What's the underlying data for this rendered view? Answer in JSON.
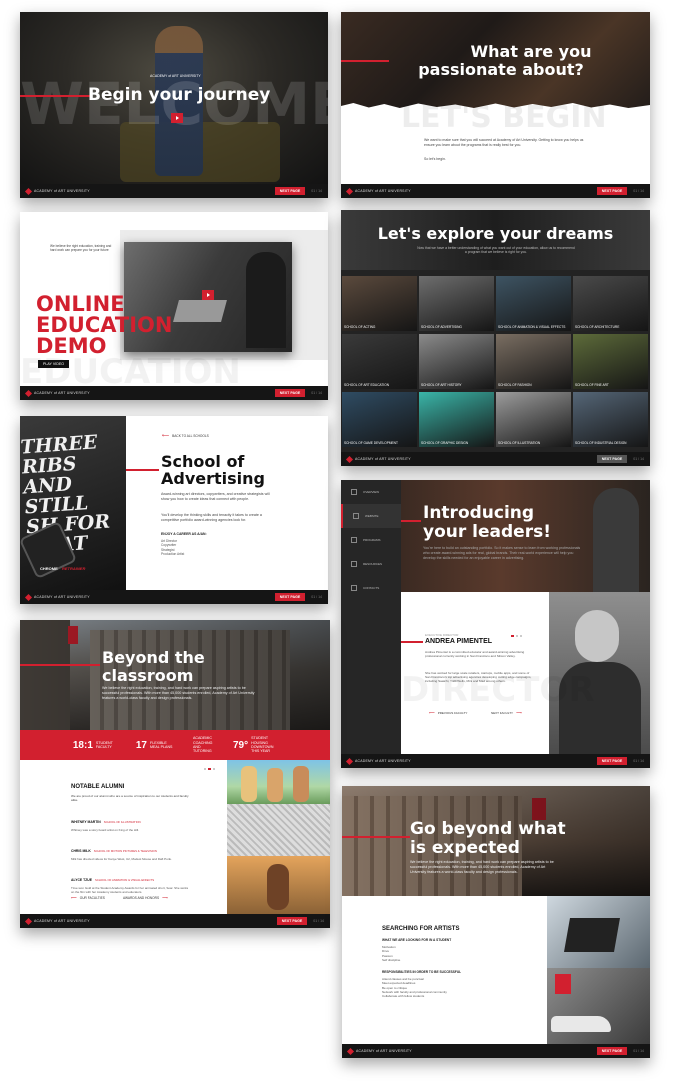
{
  "footer": {
    "brand": "ACADEMY of ART UNIVERSITY",
    "next_label": "NEXT PAGE",
    "page": "01 / 14"
  },
  "card1": {
    "ghost": "WELCOME",
    "headline": "Begin your journey",
    "logo": "ACADEMY of ART UNIVERSITY"
  },
  "card2": {
    "ghost": "LET'S BEGIN",
    "headline_line1": "What are you",
    "headline_line2": "passionate about?",
    "body": "We want to make sure that you will succeed at Academy of Art University. Getting to know you helps us ensure you learn about the programs that is really best for you.",
    "signoff": "So let's begin."
  },
  "card3": {
    "intro": "We believe the right education, training and hard work can prepare you for your future",
    "headline_line1": "ONLINE",
    "headline_line2": "EDUCATION",
    "headline_line3": "DEMO",
    "button": "PLAY VIDEO",
    "ghost": "EDUCATION"
  },
  "card4": {
    "headline": "Let's explore your dreams",
    "subtitle": "Now that we have a better understanding of what you want out of your education, allow us to recommend a program that we believe is right for you.",
    "schools": [
      "SCHOOL OF ACTING",
      "SCHOOL OF ADVERTISING",
      "SCHOOL OF ANIMATION & VISUAL EFFECTS",
      "SCHOOL OF ARCHITECTURE",
      "SCHOOL OF ART EDUCATION",
      "SCHOOL OF ART HISTORY",
      "SCHOOL OF FASHION",
      "SCHOOL OF FINE ART",
      "SCHOOL OF GAME DEVELOPMENT",
      "SCHOOL OF GRAPHIC DESIGN",
      "SCHOOL OF ILLUSTRATION",
      "SCHOOL OF INDUSTRIAL DESIGN"
    ]
  },
  "card5": {
    "back": "BACK TO ALL SCHOOLS",
    "headline_line1": "School of",
    "headline_line2": "Advertising",
    "p1": "Award-winning art directors, copywriters, and creative strategists will show you how to create ideas that connect with people.",
    "p2": "You'll develop the thinking skills and tenacity it takes to create a competitive portfolio award-winning agencies look for.",
    "careers_title": "ENJOY A CAREER AS A/AN:",
    "careers": [
      "Art Director",
      "Copywriter",
      "Strategist",
      "Production Artist"
    ],
    "poster_text": "THREE RIBS AND STILL SH FOR THAT",
    "poster_brand": "CHROME",
    "poster_tag": "RETRAINER"
  },
  "card6": {
    "nav": [
      "OVERVIEW",
      "WEBSITE",
      "PROGRAMS",
      "RESOURCES",
      "CONTACTS"
    ],
    "headline_line1": "Introducing",
    "headline_line2": "your leaders!",
    "body": "You're here to build an outstanding portfolio. So it makes sense to learn from working professionals who create award-winning ads for real, global brands. Their real-world experience will help you develop the skills needed for an enjoyable career in advertising.",
    "role": "EXECUTIVE DIRECTOR",
    "name": "ANDREA PIMENTEL",
    "bio1": "Andrea Pimentel is a committed educator and award-winning advertising professional currently working in San Francisco and Silicon Valley.",
    "bio2": "She has worked for large scale retailers, startups, mobile apps, and some of San Francisco's top advertising agencies developing cutting edge campaigns, including Saatchi, Y&R/Wells, Mini and Mad among others.",
    "prev": "PREVIOUS FACULTY",
    "next": "NEXT FACULTY",
    "ghost": "DIRECTOR"
  },
  "card7": {
    "headline_line1": "Beyond the",
    "headline_line2": "classroom",
    "body": "We believe the right education, training, and hard work can prepare aspiring artists to be successful professionals. With more than 45,000 students enrolled, Academy of Art University features a world-class faculty and design professionals.",
    "stats": [
      {
        "big": "18:1",
        "small": "STUDENT FACULTY"
      },
      {
        "big": "17",
        "small": "FLEXIBLE MEAL PLANS"
      },
      {
        "big": "",
        "small": "ACADEMIC COACHING AND TUTORING"
      },
      {
        "big": "79°",
        "small": "STUDENT HOUSING DOWNTOWN THIS YEAR"
      }
    ],
    "alumni_title": "NOTABLE ALUMNI",
    "alumni_intro": "We are proud of our alumni who are a source of inspiration to our students and faculty alike.",
    "alumni": [
      {
        "name": "WHITNEY MARTIN",
        "school": "SCHOOL OF ILLUSTRATION",
        "desc": "Whitney was a story board artist on King of the Hill."
      },
      {
        "name": "CHRIS MILK",
        "school": "SCHOOL OF MOTION PICTURES & TELEVISION",
        "desc": "Milk has directed videos for Kanye West, U2, Modest Mouse and Daft Punk."
      },
      {
        "name": "ALYCE TZUE",
        "school": "SCHOOL OF ANIMATION & VISUAL EFFECTS",
        "desc": "Tzue won Gold at the Student Academy Awards for her animated short, Soar. She works on the film with her Academy students and educators."
      }
    ],
    "link1": "OUR FACULTIES",
    "link2": "AWARDS AND HONORS"
  },
  "card8": {
    "headline_line1": "Go beyond what",
    "headline_line2": "is expected",
    "body": "We believe the right education, training, and hard work can prepare aspiring artists to be successful professionals. With more than 45,000 students enrolled, Academy of Art University features a world-class faculty and design professionals.",
    "section": "SEARCHING FOR ARTISTS",
    "sub1": "WHAT WE ARE LOOKING FOR IN A STUDENT",
    "list1": [
      "Motivation",
      "Drive",
      "Passion",
      "Self discipline"
    ],
    "sub2": "RESPONSIBILITIES IN ORDER TO BE SUCCESSFUL",
    "list2": [
      "Attend classes and be punctual",
      "Meet expected deadlines",
      "Be open to critique",
      "Network with faculty and professional community",
      "Collaborate with fellow students"
    ]
  }
}
